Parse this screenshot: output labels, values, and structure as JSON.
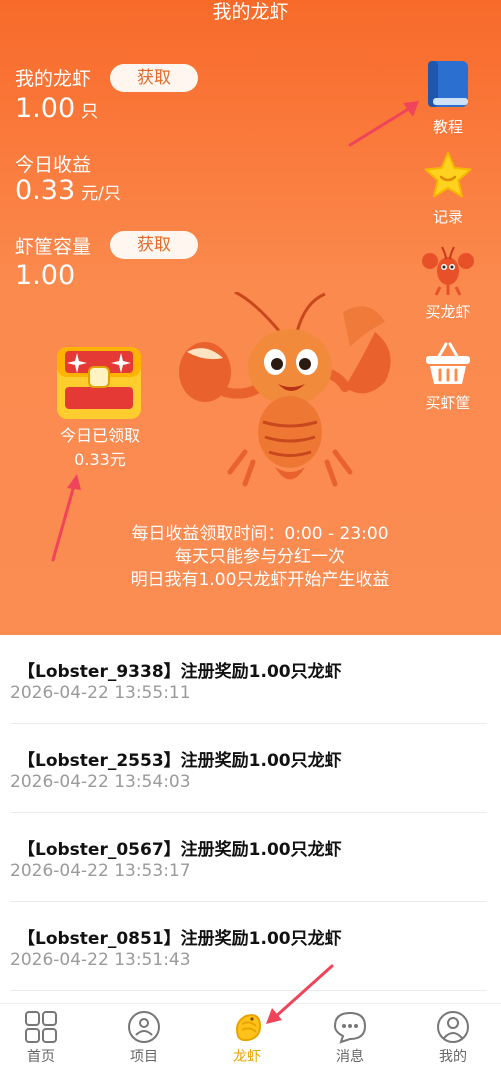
{
  "header": {
    "title": "我的龙虾"
  },
  "stats": {
    "my_lobster_label": "我的龙虾",
    "my_lobster_btn": "获取",
    "my_lobster_value": "1.00",
    "my_lobster_unit": "只",
    "today_income_label": "今日收益",
    "today_income_value": "0.33",
    "today_income_unit": "元/只",
    "capacity_label": "虾筐容量",
    "capacity_btn": "获取",
    "capacity_value": "1.00"
  },
  "side_menu": {
    "tutorial": "教程",
    "records": "记录",
    "buy_lobster": "买龙虾",
    "buy_basket": "买虾筐"
  },
  "chest": {
    "line1": "今日已领取",
    "line2": "0.33元"
  },
  "info": {
    "line1": "每日收益领取时间：0:00 - 23:00",
    "line2": "每天只能参与分红一次",
    "line3": "明日我有1.00只龙虾开始产生收益"
  },
  "records": [
    {
      "title": "【Lobster_9338】注册奖励1.00只龙虾",
      "time": "2026-04-22 13:55:11"
    },
    {
      "title": "【Lobster_2553】注册奖励1.00只龙虾",
      "time": "2026-04-22 13:54:03"
    },
    {
      "title": "【Lobster_0567】注册奖励1.00只龙虾",
      "time": "2026-04-22 13:53:17"
    },
    {
      "title": "【Lobster_0851】注册奖励1.00只龙虾",
      "time": "2026-04-22 13:51:43"
    }
  ],
  "tabbar": {
    "home": "首页",
    "projects": "项目",
    "lobster": "龙虾",
    "messages": "消息",
    "mine": "我的"
  },
  "colors": {
    "hero_top": "#f86a2a",
    "hero_bottom": "#fb8c52",
    "active_tab": "#e8a400",
    "arrow": "#f0445a"
  }
}
